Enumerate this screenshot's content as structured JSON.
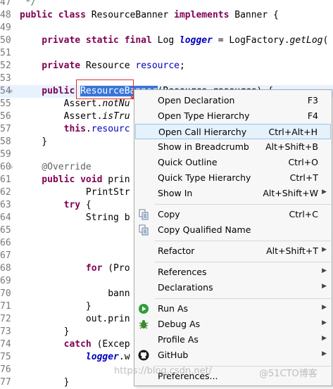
{
  "editor": {
    "lines": [
      {
        "num": "47",
        "segments": [
          {
            "t": " */",
            "c": "cm"
          }
        ]
      },
      {
        "num": "48",
        "segments": [
          {
            "t": "public class ",
            "c": "kw"
          },
          {
            "t": "ResourceBanner ",
            "c": ""
          },
          {
            "t": "implements ",
            "c": "kw"
          },
          {
            "t": "Banner {",
            "c": ""
          }
        ]
      },
      {
        "num": "49",
        "segments": []
      },
      {
        "num": "50",
        "segments": [
          {
            "t": "    private static final ",
            "c": "kw"
          },
          {
            "t": "Log ",
            "c": ""
          },
          {
            "t": "logger",
            "c": "fldi"
          },
          {
            "t": " = LogFactory.",
            "c": ""
          },
          {
            "t": "getLog",
            "c": "itl"
          },
          {
            "t": "(",
            "c": ""
          }
        ]
      },
      {
        "num": "51",
        "segments": []
      },
      {
        "num": "52",
        "segments": [
          {
            "t": "    private ",
            "c": "kw"
          },
          {
            "t": "Resource ",
            "c": ""
          },
          {
            "t": "resource",
            "c": "fld"
          },
          {
            "t": ";",
            "c": ""
          }
        ]
      },
      {
        "num": "53",
        "segments": []
      },
      {
        "num": "54",
        "fold": "⊖",
        "current": true,
        "segments": [
          {
            "t": "    public ",
            "c": "kw"
          },
          {
            "t": "ResourceBanner",
            "c": "sel"
          },
          {
            "t": "(Resource resource) {",
            "c": ""
          }
        ]
      },
      {
        "num": "55",
        "segments": [
          {
            "t": "        Assert.",
            "c": ""
          },
          {
            "t": "notNu",
            "c": "itl"
          }
        ]
      },
      {
        "num": "56",
        "segments": [
          {
            "t": "        Assert.",
            "c": ""
          },
          {
            "t": "isTru",
            "c": "itl"
          }
        ]
      },
      {
        "num": "57",
        "segments": [
          {
            "t": "        this",
            "c": "kw"
          },
          {
            "t": ".",
            "c": ""
          },
          {
            "t": "resourc",
            "c": "fld"
          }
        ]
      },
      {
        "num": "58",
        "segments": [
          {
            "t": "    }",
            "c": ""
          }
        ]
      },
      {
        "num": "59",
        "segments": []
      },
      {
        "num": "60",
        "fold": "⊖",
        "segments": [
          {
            "t": "    @Override",
            "c": "ann"
          }
        ]
      },
      {
        "num": "61",
        "segments": [
          {
            "t": "    public void ",
            "c": "kw"
          },
          {
            "t": "prin",
            "c": ""
          }
        ]
      },
      {
        "num": "62",
        "segments": [
          {
            "t": "            PrintStr",
            "c": ""
          }
        ]
      },
      {
        "num": "63",
        "segments": [
          {
            "t": "        try ",
            "c": "kw"
          },
          {
            "t": "{",
            "c": ""
          }
        ]
      },
      {
        "num": "64",
        "segments": [
          {
            "t": "            String b",
            "c": ""
          }
        ]
      },
      {
        "num": "65",
        "segments": []
      },
      {
        "num": "66",
        "segments": []
      },
      {
        "num": "67",
        "segments": []
      },
      {
        "num": "68",
        "segments": [
          {
            "t": "            for ",
            "c": "kw"
          },
          {
            "t": "(Pro",
            "c": ""
          }
        ]
      },
      {
        "num": "69",
        "segments": []
      },
      {
        "num": "70",
        "segments": [
          {
            "t": "                bann",
            "c": ""
          }
        ]
      },
      {
        "num": "71",
        "segments": [
          {
            "t": "            }",
            "c": ""
          }
        ]
      },
      {
        "num": "72",
        "segments": [
          {
            "t": "            out.prin",
            "c": ""
          }
        ]
      },
      {
        "num": "73",
        "segments": [
          {
            "t": "        }",
            "c": ""
          }
        ]
      },
      {
        "num": "74",
        "segments": [
          {
            "t": "        catch ",
            "c": "kw"
          },
          {
            "t": "(Excep",
            "c": ""
          }
        ]
      },
      {
        "num": "75",
        "segments": [
          {
            "t": "            ",
            "c": ""
          },
          {
            "t": "logger",
            "c": "fldi"
          },
          {
            "t": ".w",
            "c": ""
          }
        ]
      },
      {
        "num": "76",
        "segments": []
      },
      {
        "num": "77",
        "segments": [
          {
            "t": "        }",
            "c": ""
          }
        ]
      }
    ]
  },
  "context_menu": {
    "items": [
      {
        "label": "Open Declaration",
        "shortcut": "F3",
        "icon": "",
        "submenu": false
      },
      {
        "label": "Open Type Hierarchy",
        "shortcut": "F4",
        "icon": "",
        "submenu": false
      },
      {
        "label": "Open Call Hierarchy",
        "shortcut": "Ctrl+Alt+H",
        "icon": "",
        "submenu": false,
        "hover": true
      },
      {
        "label": "Show in Breadcrumb",
        "shortcut": "Alt+Shift+B",
        "icon": "",
        "submenu": false
      },
      {
        "label": "Quick Outline",
        "shortcut": "Ctrl+O",
        "icon": "",
        "submenu": false
      },
      {
        "label": "Quick Type Hierarchy",
        "shortcut": "Ctrl+T",
        "icon": "",
        "submenu": false
      },
      {
        "label": "Show In",
        "shortcut": "Alt+Shift+W",
        "icon": "",
        "submenu": true
      },
      {
        "sep": true
      },
      {
        "label": "Copy",
        "shortcut": "Ctrl+C",
        "icon": "copy-icon",
        "submenu": false
      },
      {
        "label": "Copy Qualified Name",
        "shortcut": "",
        "icon": "copy-qualified-name-icon",
        "submenu": false
      },
      {
        "sep": true
      },
      {
        "label": "Refactor",
        "shortcut": "Alt+Shift+T",
        "icon": "",
        "submenu": true
      },
      {
        "sep": true
      },
      {
        "label": "References",
        "shortcut": "",
        "icon": "",
        "submenu": true
      },
      {
        "label": "Declarations",
        "shortcut": "",
        "icon": "",
        "submenu": true
      },
      {
        "sep": true
      },
      {
        "label": "Run As",
        "shortcut": "",
        "icon": "run-icon",
        "submenu": true
      },
      {
        "label": "Debug As",
        "shortcut": "",
        "icon": "debug-bug-icon",
        "submenu": true
      },
      {
        "label": "Profile As",
        "shortcut": "",
        "icon": "",
        "submenu": true
      },
      {
        "label": "GitHub",
        "shortcut": "",
        "icon": "github-icon",
        "submenu": true
      },
      {
        "sep": true
      },
      {
        "label": "Preferences...",
        "shortcut": "",
        "icon": "",
        "submenu": false
      }
    ]
  },
  "watermark": {
    "url": "https://blog.csdn.net/",
    "brand": "@51CTO博客"
  },
  "colors": {
    "keyword": "#7f0055",
    "field": "#0000c0",
    "selection": "#3875d7",
    "annotation_red": "#e03030",
    "menu_hover": "#e5f1fb"
  }
}
